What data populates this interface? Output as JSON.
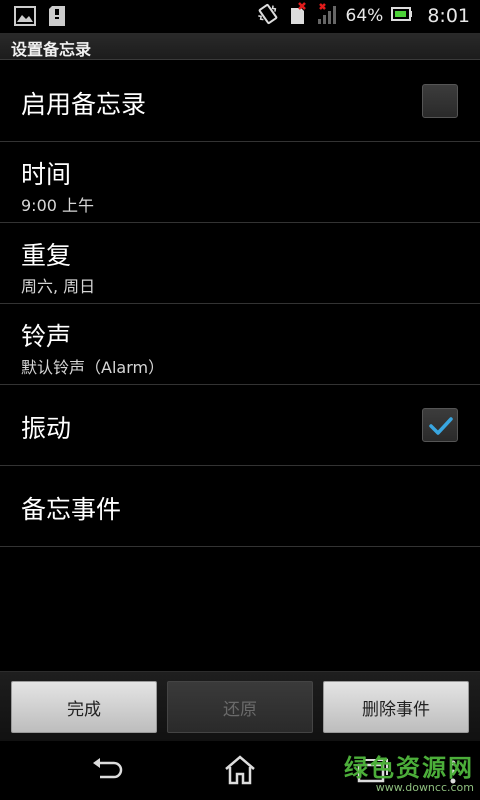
{
  "status_bar": {
    "battery_text": "64%",
    "time": "8:01",
    "icons": [
      "image-icon",
      "sd-card-icon",
      "vibrate-icon",
      "no-sim-icon",
      "signal-icon",
      "battery-icon"
    ]
  },
  "title_bar": {
    "title": "设置备忘录"
  },
  "settings": {
    "enable": {
      "title": "启用备忘录",
      "checked": false
    },
    "time": {
      "title": "时间",
      "value": "9:00 上午"
    },
    "repeat": {
      "title": "重复",
      "value": "周六, 周日"
    },
    "ringtone": {
      "title": "铃声",
      "value": "默认铃声（Alarm）"
    },
    "vibrate": {
      "title": "振动",
      "checked": true
    },
    "event": {
      "title": "备忘事件"
    }
  },
  "buttons": {
    "done": "完成",
    "revert": "还原",
    "delete": "删除事件"
  },
  "nav": {
    "icons": [
      "back-icon",
      "home-icon",
      "recent-apps-icon",
      "menu-icon"
    ]
  },
  "watermark": {
    "brand": "绿色资源网",
    "url": "www.downcc.com"
  },
  "colors": {
    "checkbox_check": "#39a6e0",
    "watermark_green": "#4cae3a"
  }
}
